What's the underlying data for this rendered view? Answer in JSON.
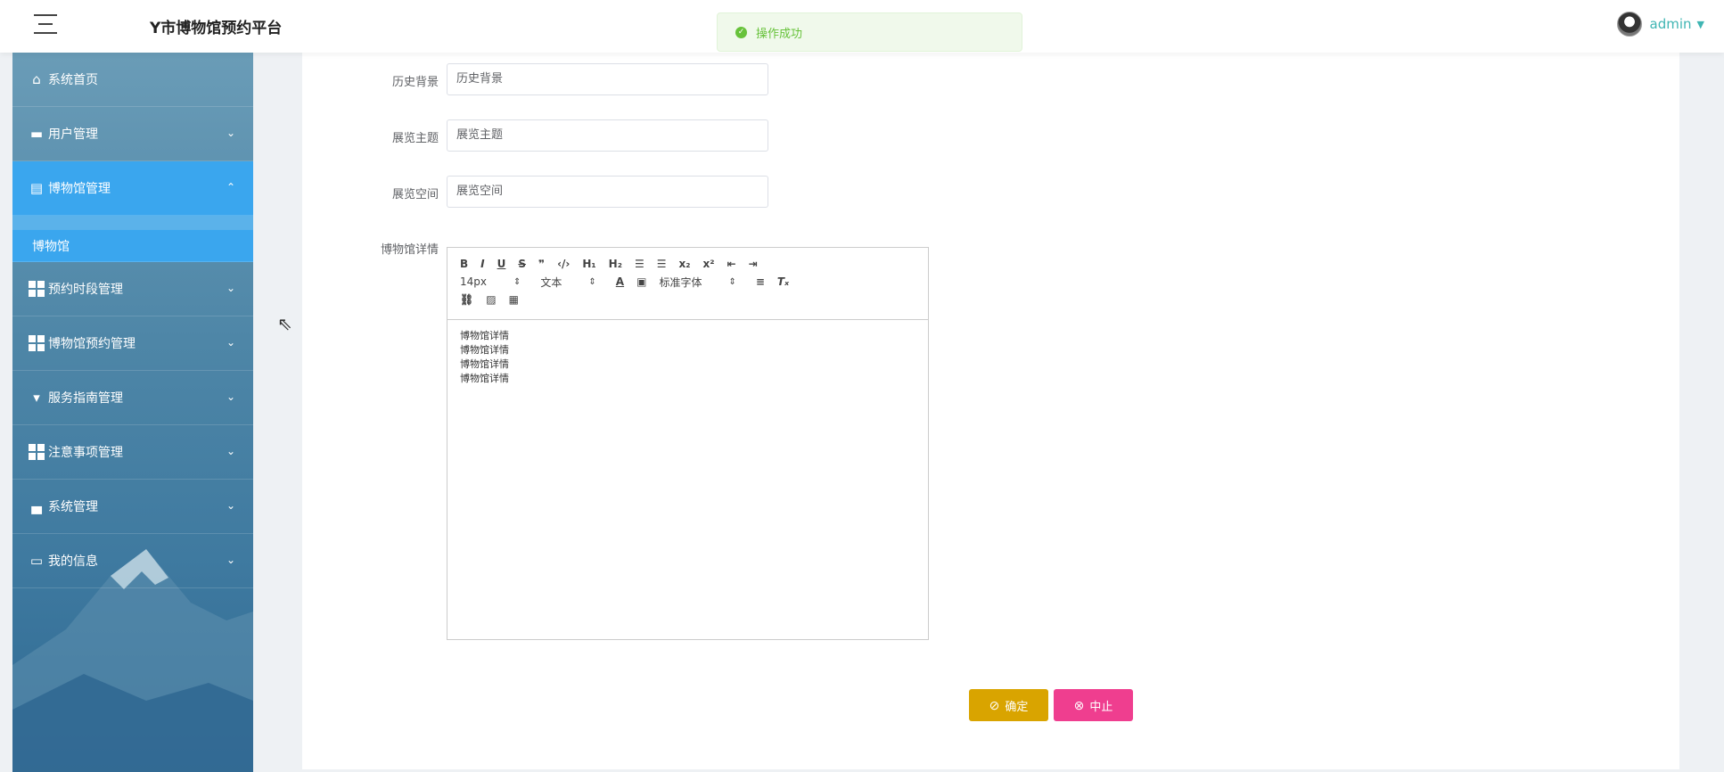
{
  "header": {
    "title": "Y市博物馆预约平台",
    "toast": "操作成功",
    "user": "admin"
  },
  "sidebar": {
    "items": [
      {
        "label": "系统首页"
      },
      {
        "label": "用户管理"
      },
      {
        "label": "博物馆管理"
      },
      {
        "label": "预约时段管理"
      },
      {
        "label": "博物馆预约管理"
      },
      {
        "label": "服务指南管理"
      },
      {
        "label": "注意事项管理"
      },
      {
        "label": "系统管理"
      },
      {
        "label": "我的信息"
      }
    ],
    "sub_item": "博物馆"
  },
  "form": {
    "history_label": "历史背景",
    "history_value": "历史背景",
    "theme_label": "展览主题",
    "theme_value": "展览主题",
    "space_label": "展览空间",
    "space_value": "展览空间",
    "detail_label": "博物馆详情",
    "detail_lines": [
      "博物馆详情",
      "博物馆详情",
      "博物馆详情",
      "博物馆详情"
    ]
  },
  "editor": {
    "font_size": "14px",
    "text_type": "文本",
    "font_family": "标准字体"
  },
  "buttons": {
    "confirm": "确定",
    "cancel": "中止"
  },
  "colors": {
    "accent": "#3aa6ee",
    "confirm": "#d9a400",
    "cancel": "#ef3e8f",
    "success": "#67c23a"
  }
}
